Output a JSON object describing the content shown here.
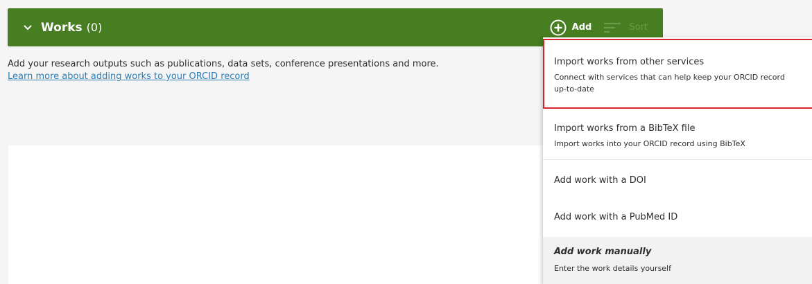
{
  "works": {
    "title": "Works",
    "count": "(0)",
    "add_label": "Add",
    "sort_label": "Sort",
    "description": "Add your research outputs such as publications, data sets, conference presentations and more.",
    "learn_more": "Learn more about adding works to your ORCID record"
  },
  "menu": {
    "items": [
      {
        "title": "Import works from other services",
        "subtitle": "Connect with services that can help keep your ORCID record",
        "subtitle2": "up-to-date"
      },
      {
        "title": "Import works from a BibTeX file",
        "subtitle": "Import works into your ORCID record using BibTeX"
      },
      {
        "title": "Add work with a DOI"
      },
      {
        "title": "Add work with a PubMed ID"
      },
      {
        "title": "Add work manually",
        "subtitle": "Enter the work details yourself"
      }
    ]
  },
  "colors": {
    "header_green": "#477e21",
    "focus_red": "#d9232e",
    "link_blue": "#2e7db3"
  }
}
